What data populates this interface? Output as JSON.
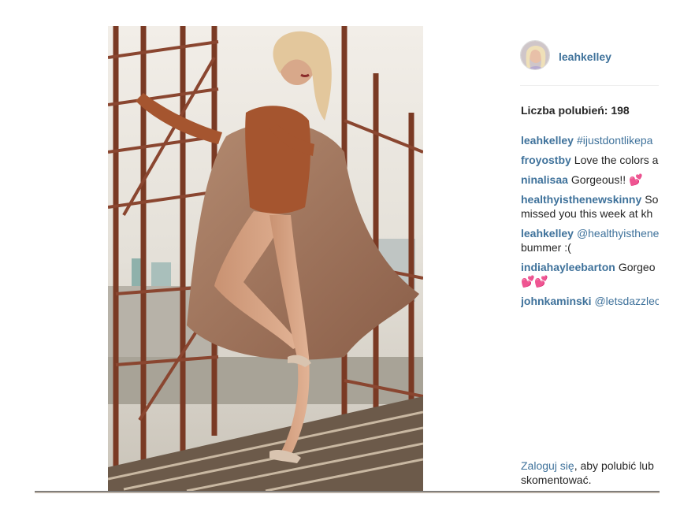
{
  "post": {
    "image_alt": "woman posing on fire escape staircase"
  },
  "header": {
    "username": "leahkelley"
  },
  "likes": {
    "text": "Liczba polubień: 198"
  },
  "comments": [
    {
      "user": "leahkelley",
      "text": "#ijustdontlikepa",
      "is_tag": true,
      "line2": ""
    },
    {
      "user": "froyostby",
      "text": "Love the colors a",
      "is_tag": false,
      "line2": ""
    },
    {
      "user": "ninalisaa",
      "text": "Gorgeous!! 💕",
      "is_tag": false,
      "line2": ""
    },
    {
      "user": "healthyisthenewskinny",
      "text": "So",
      "is_tag": false,
      "line2": "missed you this week at kh"
    },
    {
      "user": "leahkelley",
      "text": "@healthyisthene",
      "is_tag": true,
      "line2": "bummer :("
    },
    {
      "user": "indiahayleebarton",
      "text": "Gorgeo",
      "is_tag": false,
      "line2": "💕💕"
    },
    {
      "user": "johnkaminski",
      "text": "@letsdazzlec",
      "is_tag": true,
      "line2": ""
    }
  ],
  "login_prompt": {
    "link": "Zaloguj się",
    "text": ", aby polubić lub",
    "line2": "skomentować."
  },
  "colors": {
    "link": "#3f729b",
    "text": "#262626"
  }
}
